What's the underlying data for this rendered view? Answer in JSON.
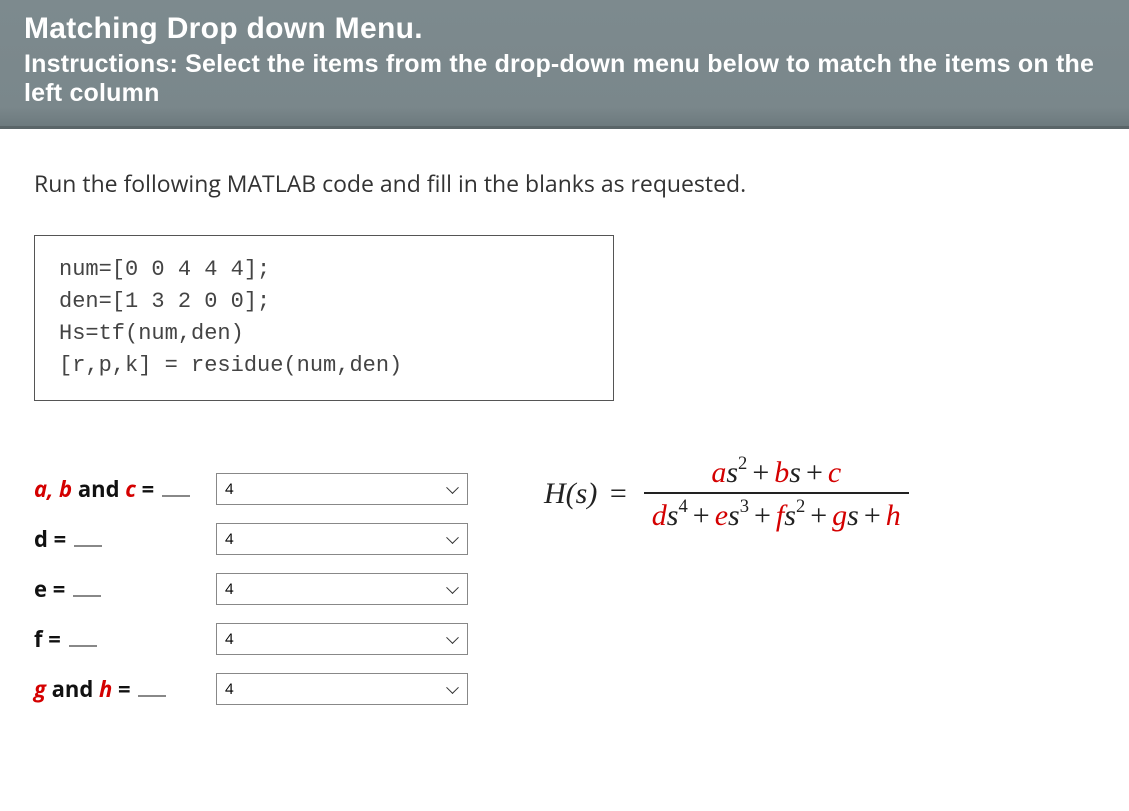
{
  "header": {
    "title": "Matching Drop down Menu.",
    "instructions": "Instructions: Select the items from the drop-down menu below to match the items on the left column"
  },
  "prompt": "Run the following MATLAB code and fill in the blanks as requested.",
  "code": "num=[0 0 4 4 4];\nden=[1 3 2 0 0];\nHs=tf(num,den)\n[r,p,k] = residue(num,den)",
  "form": {
    "rows": [
      {
        "labelParts": [
          {
            "t": "a, b",
            "red": true
          },
          {
            "t": " and ",
            "red": false
          },
          {
            "t": "c",
            "red": true
          },
          {
            "t": " = ",
            "red": false
          }
        ],
        "blank": true,
        "value": "4"
      },
      {
        "labelParts": [
          {
            "t": "d = ",
            "red": false
          }
        ],
        "blank": true,
        "value": "4"
      },
      {
        "labelParts": [
          {
            "t": "e = ",
            "red": false
          }
        ],
        "blank": true,
        "value": "4"
      },
      {
        "labelParts": [
          {
            "t": "f = ",
            "red": false
          }
        ],
        "blank": true,
        "value": "4"
      },
      {
        "labelParts": [
          {
            "t": "g",
            "red": true
          },
          {
            "t": " and ",
            "red": false
          },
          {
            "t": "h",
            "red": true
          },
          {
            "t": " = ",
            "red": false
          }
        ],
        "blank": true,
        "value": "4"
      }
    ]
  },
  "equation": {
    "lhs": "H(s) =",
    "num": {
      "terms": [
        {
          "coef": "a",
          "red": true,
          "var": "s",
          "pow": "2"
        },
        {
          "coef": "b",
          "red": true,
          "var": "s",
          "pow": ""
        },
        {
          "coef": "c",
          "red": true,
          "var": "",
          "pow": ""
        }
      ]
    },
    "den": {
      "terms": [
        {
          "coef": "d",
          "red": true,
          "var": "s",
          "pow": "4"
        },
        {
          "coef": "e",
          "red": true,
          "var": "s",
          "pow": "3"
        },
        {
          "coef": "f",
          "red": true,
          "var": "s",
          "pow": "2"
        },
        {
          "coef": "g",
          "red": true,
          "var": "s",
          "pow": ""
        },
        {
          "coef": "h",
          "red": true,
          "var": "",
          "pow": ""
        }
      ]
    }
  }
}
